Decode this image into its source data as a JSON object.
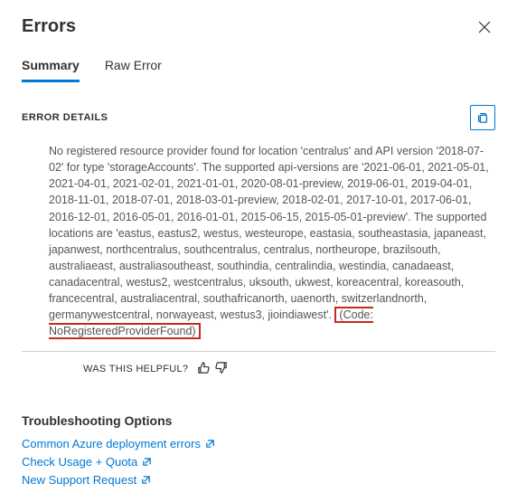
{
  "panel": {
    "title": "Errors"
  },
  "tabs": {
    "summary": "Summary",
    "raw": "Raw Error"
  },
  "details": {
    "label": "ERROR DETAILS",
    "message_pre": "No registered resource provider found for location 'centralus' and API version '2018-07-02' for type 'storageAccounts'. The supported api-versions are '2021-06-01, 2021-05-01, 2021-04-01, 2021-02-01, 2021-01-01, 2020-08-01-preview, 2019-06-01, 2019-04-01, 2018-11-01, 2018-07-01, 2018-03-01-preview, 2018-02-01, 2017-10-01, 2017-06-01, 2016-12-01, 2016-05-01, 2016-01-01, 2015-06-15, 2015-05-01-preview'. The supported locations are 'eastus, eastus2, westus, westeurope, eastasia, southeastasia, japaneast, japanwest, northcentralus, southcentralus, centralus, northeurope, brazilsouth, australiaeast, australiasoutheast, southindia, centralindia, westindia, canadaeast, canadacentral, westus2, westcentralus, uksouth, ukwest, koreacentral, koreasouth, francecentral, australiacentral, southafricanorth, uaenorth, switzerlandnorth, germanywestcentral, norwayeast, westus3, jioindiawest'. ",
    "error_code": "(Code: NoRegisteredProviderFound)"
  },
  "feedback": {
    "label": "WAS THIS HELPFUL?"
  },
  "troubleshooting": {
    "title": "Troubleshooting Options",
    "links": {
      "common": "Common Azure deployment errors",
      "quota": "Check Usage + Quota",
      "support": "New Support Request"
    }
  }
}
